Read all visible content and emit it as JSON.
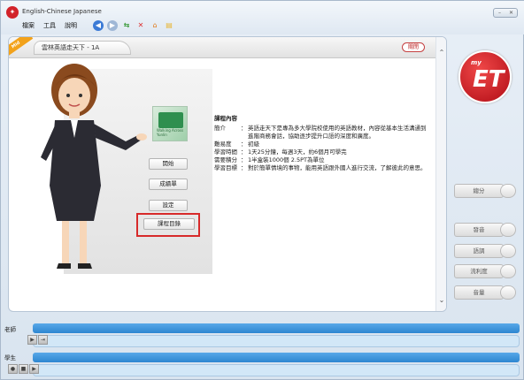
{
  "window": {
    "title": "English-Chinese Japanese",
    "menu": [
      "檔案",
      "工具",
      "說明"
    ]
  },
  "tab": {
    "ribbon": "Mid",
    "label": "雲林英語走天下 - 1A",
    "button": "關閉"
  },
  "course": {
    "card_text": "Walking Across Yunlin",
    "buttons": [
      "開始",
      "成績單",
      "設定",
      "課程目錄"
    ]
  },
  "details": {
    "header": "課程內容",
    "rows": [
      {
        "k": "簡介",
        "v": "英語走天下是專為多大學院校使用的英語教材，內容從基本生活溝通到進階商務會話，協助逐步提升口語的深度和廣度。"
      },
      {
        "k": "難易度",
        "v": "初級"
      },
      {
        "k": "學習時間",
        "v": "1天25分鐘，每週3天，約6個月可學完"
      },
      {
        "k": "需要積分",
        "v": "1半盒裝1000個 2.5PT為單位"
      },
      {
        "k": "學習目標",
        "v": "對於簡單情境的事物，能用英語跟外國人進行交流，了解彼此的意思。"
      }
    ]
  },
  "brand": {
    "small": "my",
    "big": "ET"
  },
  "side_buttons": [
    "總分",
    "發音",
    "語調",
    "流利度",
    "音量"
  ],
  "bottom": {
    "teacher": "老師",
    "student": "學生"
  },
  "colors": {
    "accent": "#2d86d1",
    "brand": "#c8141e",
    "highlight": "#d72a2a"
  }
}
